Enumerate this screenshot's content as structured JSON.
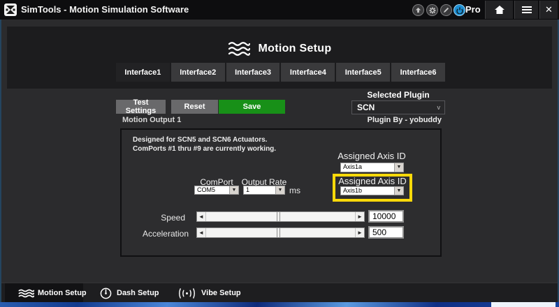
{
  "titlebar": {
    "title": "SimTools - Motion Simulation Software",
    "edition": "Pro",
    "close_glyph": "✕"
  },
  "header": {
    "title": "Motion Setup",
    "tabs": [
      {
        "label": "Interface1",
        "active": true
      },
      {
        "label": "Interface2",
        "active": false
      },
      {
        "label": "Interface3",
        "active": false
      },
      {
        "label": "Interface4",
        "active": false
      },
      {
        "label": "Interface5",
        "active": false
      },
      {
        "label": "Interface6",
        "active": false
      }
    ]
  },
  "toolbar": {
    "test_settings_label": "Test Settings",
    "reset_label": "Reset",
    "save_label": "Save",
    "save_color": "#189018",
    "selected_plugin_label": "Selected Plugin",
    "selected_plugin_value": "SCN",
    "plugin_chevron": "v"
  },
  "output_panel": {
    "title": "Motion Output 1",
    "plugin_by": "Plugin By - yobuddy",
    "description": [
      "Designed for SCN5 and SCN6 Actuators.",
      "ComPorts #1 thru #9 are currently working."
    ],
    "axis_a": {
      "label": "Assigned Axis ID",
      "value": "Axis1a"
    },
    "axis_b": {
      "label": "Assigned Axis ID",
      "value": "Axis1b",
      "highlight_color": "#ffd90a"
    },
    "comport": {
      "label": "ComPort",
      "value": "COM5"
    },
    "output_rate": {
      "label": "Output Rate",
      "value": "1",
      "unit": "ms"
    },
    "speed": {
      "label": "Speed",
      "value": "10000",
      "thumb_percent": 49
    },
    "acceleration": {
      "label": "Acceleration",
      "value": "500",
      "thumb_percent": 49
    },
    "slider_left_arrow": "◄",
    "slider_right_arrow": "►",
    "combo_arrow": "▼"
  },
  "bottom_nav": {
    "items": [
      {
        "label": "Motion Setup",
        "active": true
      },
      {
        "label": "Dash Setup",
        "active": false
      },
      {
        "label": "Vibe Setup",
        "active": false
      }
    ]
  }
}
